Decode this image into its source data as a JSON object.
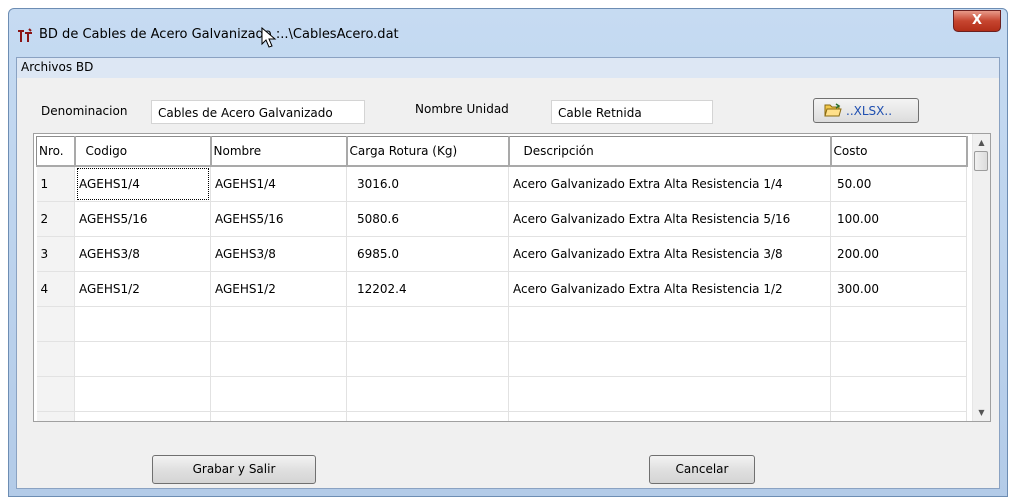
{
  "window": {
    "title": "BD de  Cables de Acero Galvanizado :..\\CablesAcero.dat",
    "close_label": "X",
    "app_icon": "t-structure-icon"
  },
  "menu": {
    "items": [
      "Archivos BD"
    ]
  },
  "form": {
    "denominacion_label": "Denominacion",
    "denominacion_value": "Cables de Acero Galvanizado",
    "nombre_unidad_label": "Nombre Unidad",
    "nombre_unidad_value": "Cable Retnida",
    "xlsx_label": "..XLSX.."
  },
  "table": {
    "headers": [
      "Nro.",
      "Codigo",
      "Nombre",
      "Carga Rotura  (Kg)",
      "Descripción",
      "Costo"
    ],
    "rows": [
      [
        "1",
        "AGEHS1/4",
        "AGEHS1/4",
        "3016.0",
        "Acero Galvanizado Extra Alta Resistencia 1/4",
        "50.00"
      ],
      [
        "2",
        "AGEHS5/16",
        "AGEHS5/16",
        "5080.6",
        "Acero Galvanizado Extra Alta Resistencia 5/16",
        "100.00"
      ],
      [
        "3",
        "AGEHS3/8",
        "AGEHS3/8",
        "6985.0",
        "Acero Galvanizado Extra Alta Resistencia 3/8",
        "200.00"
      ],
      [
        "4",
        "AGEHS1/2",
        "AGEHS1/2",
        "12202.4",
        "Acero Galvanizado Extra Alta Resistencia 1/2",
        "300.00"
      ]
    ]
  },
  "buttons": {
    "save": "Grabar y Salir",
    "cancel": "Cancelar"
  }
}
